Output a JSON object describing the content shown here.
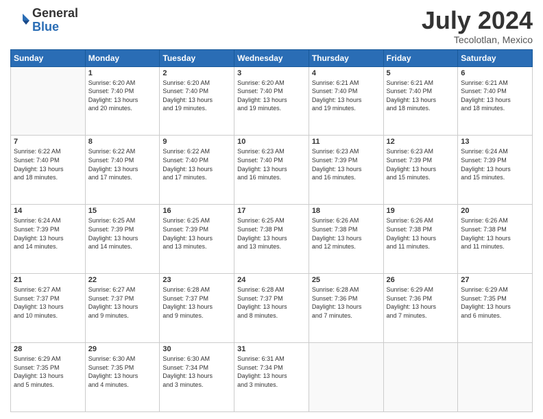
{
  "logo": {
    "general": "General",
    "blue": "Blue"
  },
  "header": {
    "month": "July 2024",
    "location": "Tecolotlan, Mexico"
  },
  "weekdays": [
    "Sunday",
    "Monday",
    "Tuesday",
    "Wednesday",
    "Thursday",
    "Friday",
    "Saturday"
  ],
  "weeks": [
    [
      {
        "day": "",
        "info": ""
      },
      {
        "day": "1",
        "info": "Sunrise: 6:20 AM\nSunset: 7:40 PM\nDaylight: 13 hours\nand 20 minutes."
      },
      {
        "day": "2",
        "info": "Sunrise: 6:20 AM\nSunset: 7:40 PM\nDaylight: 13 hours\nand 19 minutes."
      },
      {
        "day": "3",
        "info": "Sunrise: 6:20 AM\nSunset: 7:40 PM\nDaylight: 13 hours\nand 19 minutes."
      },
      {
        "day": "4",
        "info": "Sunrise: 6:21 AM\nSunset: 7:40 PM\nDaylight: 13 hours\nand 19 minutes."
      },
      {
        "day": "5",
        "info": "Sunrise: 6:21 AM\nSunset: 7:40 PM\nDaylight: 13 hours\nand 18 minutes."
      },
      {
        "day": "6",
        "info": "Sunrise: 6:21 AM\nSunset: 7:40 PM\nDaylight: 13 hours\nand 18 minutes."
      }
    ],
    [
      {
        "day": "7",
        "info": "Sunrise: 6:22 AM\nSunset: 7:40 PM\nDaylight: 13 hours\nand 18 minutes."
      },
      {
        "day": "8",
        "info": "Sunrise: 6:22 AM\nSunset: 7:40 PM\nDaylight: 13 hours\nand 17 minutes."
      },
      {
        "day": "9",
        "info": "Sunrise: 6:22 AM\nSunset: 7:40 PM\nDaylight: 13 hours\nand 17 minutes."
      },
      {
        "day": "10",
        "info": "Sunrise: 6:23 AM\nSunset: 7:40 PM\nDaylight: 13 hours\nand 16 minutes."
      },
      {
        "day": "11",
        "info": "Sunrise: 6:23 AM\nSunset: 7:39 PM\nDaylight: 13 hours\nand 16 minutes."
      },
      {
        "day": "12",
        "info": "Sunrise: 6:23 AM\nSunset: 7:39 PM\nDaylight: 13 hours\nand 15 minutes."
      },
      {
        "day": "13",
        "info": "Sunrise: 6:24 AM\nSunset: 7:39 PM\nDaylight: 13 hours\nand 15 minutes."
      }
    ],
    [
      {
        "day": "14",
        "info": "Sunrise: 6:24 AM\nSunset: 7:39 PM\nDaylight: 13 hours\nand 14 minutes."
      },
      {
        "day": "15",
        "info": "Sunrise: 6:25 AM\nSunset: 7:39 PM\nDaylight: 13 hours\nand 14 minutes."
      },
      {
        "day": "16",
        "info": "Sunrise: 6:25 AM\nSunset: 7:39 PM\nDaylight: 13 hours\nand 13 minutes."
      },
      {
        "day": "17",
        "info": "Sunrise: 6:25 AM\nSunset: 7:38 PM\nDaylight: 13 hours\nand 13 minutes."
      },
      {
        "day": "18",
        "info": "Sunrise: 6:26 AM\nSunset: 7:38 PM\nDaylight: 13 hours\nand 12 minutes."
      },
      {
        "day": "19",
        "info": "Sunrise: 6:26 AM\nSunset: 7:38 PM\nDaylight: 13 hours\nand 11 minutes."
      },
      {
        "day": "20",
        "info": "Sunrise: 6:26 AM\nSunset: 7:38 PM\nDaylight: 13 hours\nand 11 minutes."
      }
    ],
    [
      {
        "day": "21",
        "info": "Sunrise: 6:27 AM\nSunset: 7:37 PM\nDaylight: 13 hours\nand 10 minutes."
      },
      {
        "day": "22",
        "info": "Sunrise: 6:27 AM\nSunset: 7:37 PM\nDaylight: 13 hours\nand 9 minutes."
      },
      {
        "day": "23",
        "info": "Sunrise: 6:28 AM\nSunset: 7:37 PM\nDaylight: 13 hours\nand 9 minutes."
      },
      {
        "day": "24",
        "info": "Sunrise: 6:28 AM\nSunset: 7:37 PM\nDaylight: 13 hours\nand 8 minutes."
      },
      {
        "day": "25",
        "info": "Sunrise: 6:28 AM\nSunset: 7:36 PM\nDaylight: 13 hours\nand 7 minutes."
      },
      {
        "day": "26",
        "info": "Sunrise: 6:29 AM\nSunset: 7:36 PM\nDaylight: 13 hours\nand 7 minutes."
      },
      {
        "day": "27",
        "info": "Sunrise: 6:29 AM\nSunset: 7:35 PM\nDaylight: 13 hours\nand 6 minutes."
      }
    ],
    [
      {
        "day": "28",
        "info": "Sunrise: 6:29 AM\nSunset: 7:35 PM\nDaylight: 13 hours\nand 5 minutes."
      },
      {
        "day": "29",
        "info": "Sunrise: 6:30 AM\nSunset: 7:35 PM\nDaylight: 13 hours\nand 4 minutes."
      },
      {
        "day": "30",
        "info": "Sunrise: 6:30 AM\nSunset: 7:34 PM\nDaylight: 13 hours\nand 3 minutes."
      },
      {
        "day": "31",
        "info": "Sunrise: 6:31 AM\nSunset: 7:34 PM\nDaylight: 13 hours\nand 3 minutes."
      },
      {
        "day": "",
        "info": ""
      },
      {
        "day": "",
        "info": ""
      },
      {
        "day": "",
        "info": ""
      }
    ]
  ]
}
